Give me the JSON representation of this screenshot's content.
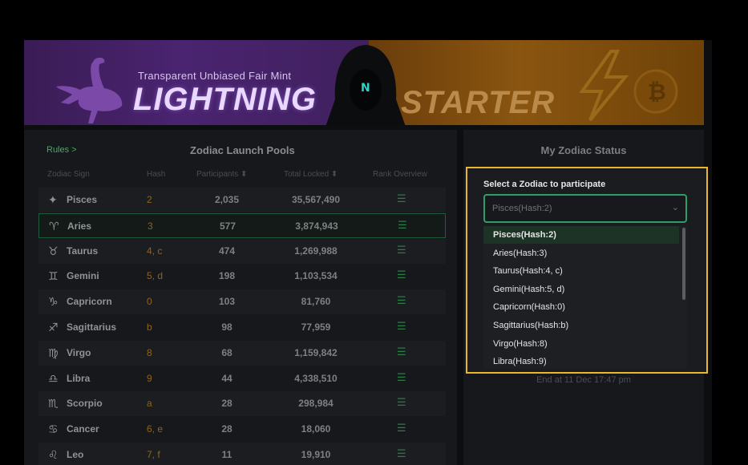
{
  "banner": {
    "tagline": "Transparent Unbiased Fair Mint",
    "word1": "LIGHTNING",
    "word2": "STARTER",
    "hood_letter": "N"
  },
  "left_panel": {
    "rules_link": "Rules >",
    "title": "Zodiac Launch Pools",
    "columns": {
      "sign": "Zodiac Sign",
      "hash": "Hash",
      "participants": "Participants ⬍",
      "locked": "Total Locked ⬍",
      "rank": "Rank Overview"
    },
    "rows": [
      {
        "icon": "✦",
        "sign": "Pisces",
        "hash": "2",
        "participants": "2,035",
        "locked": "35,567,490"
      },
      {
        "icon": "♈",
        "sign": "Aries",
        "hash": "3",
        "participants": "577",
        "locked": "3,874,943"
      },
      {
        "icon": "♉",
        "sign": "Taurus",
        "hash": "4, c",
        "participants": "474",
        "locked": "1,269,988"
      },
      {
        "icon": "♊",
        "sign": "Gemini",
        "hash": "5, d",
        "participants": "198",
        "locked": "1,103,534"
      },
      {
        "icon": "♑",
        "sign": "Capricorn",
        "hash": "0",
        "participants": "103",
        "locked": "81,760"
      },
      {
        "icon": "♐",
        "sign": "Sagittarius",
        "hash": "b",
        "participants": "98",
        "locked": "77,959"
      },
      {
        "icon": "♍",
        "sign": "Virgo",
        "hash": "8",
        "participants": "68",
        "locked": "1,159,842"
      },
      {
        "icon": "♎",
        "sign": "Libra",
        "hash": "9",
        "participants": "44",
        "locked": "4,338,510"
      },
      {
        "icon": "♏",
        "sign": "Scorpio",
        "hash": "a",
        "participants": "28",
        "locked": "298,984"
      },
      {
        "icon": "♋",
        "sign": "Cancer",
        "hash": "6, e",
        "participants": "28",
        "locked": "18,060"
      },
      {
        "icon": "♌",
        "sign": "Leo",
        "hash": "7, f",
        "participants": "11",
        "locked": "19,910"
      }
    ]
  },
  "right_panel": {
    "title": "My Zodiac Status",
    "end_at": "End at 11 Dec 17:47 pm"
  },
  "popup": {
    "label": "Select a Zodiac to participate",
    "selected": "Pisces(Hash:2)",
    "options": [
      "Pisces(Hash:2)",
      "Aries(Hash:3)",
      "Taurus(Hash:4, c)",
      "Gemini(Hash:5, d)",
      "Capricorn(Hash:0)",
      "Sagittarius(Hash:b)",
      "Virgo(Hash:8)",
      "Libra(Hash:9)"
    ]
  },
  "colors": {
    "accent_green": "#2f9e64",
    "highlight_yellow": "#e8b82a",
    "hash_orange": "#8f6420"
  }
}
